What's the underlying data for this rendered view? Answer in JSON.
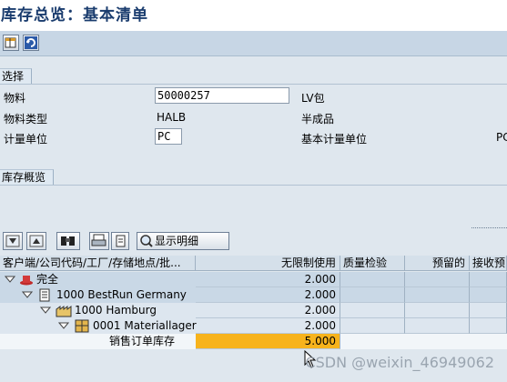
{
  "window": {
    "title": "库存总览：基本清单"
  },
  "selection": {
    "tab_label": "选择",
    "material_label": "物料",
    "material_value": "50000257",
    "material_desc": "LV包",
    "material_type_label": "物料类型",
    "material_type_value": "HALB",
    "material_type_desc": "半成品",
    "unit_label": "计量单位",
    "unit_value": "PC",
    "base_unit_label": "基本计量单位",
    "base_unit_value": "PC"
  },
  "overview": {
    "tab_label": "库存概览"
  },
  "alv_toolbar": {
    "detail_button_label": "显示明细"
  },
  "table": {
    "columns": [
      "客户端/公司代码/工厂/存储地点/批...",
      "无限制使用",
      "质量检验",
      "预留的",
      "接收预留"
    ],
    "rows": [
      {
        "label": "完全",
        "unrestricted": "2.000"
      },
      {
        "label": "1000 BestRun Germany",
        "unrestricted": "2.000"
      },
      {
        "label": "1000 Hamburg",
        "unrestricted": "2.000"
      },
      {
        "label": "0001 Materiallager",
        "unrestricted": "2.000"
      },
      {
        "label": "销售订单库存",
        "unrestricted": "5.000"
      }
    ]
  },
  "watermark": "CSDN @weixin_46949062"
}
